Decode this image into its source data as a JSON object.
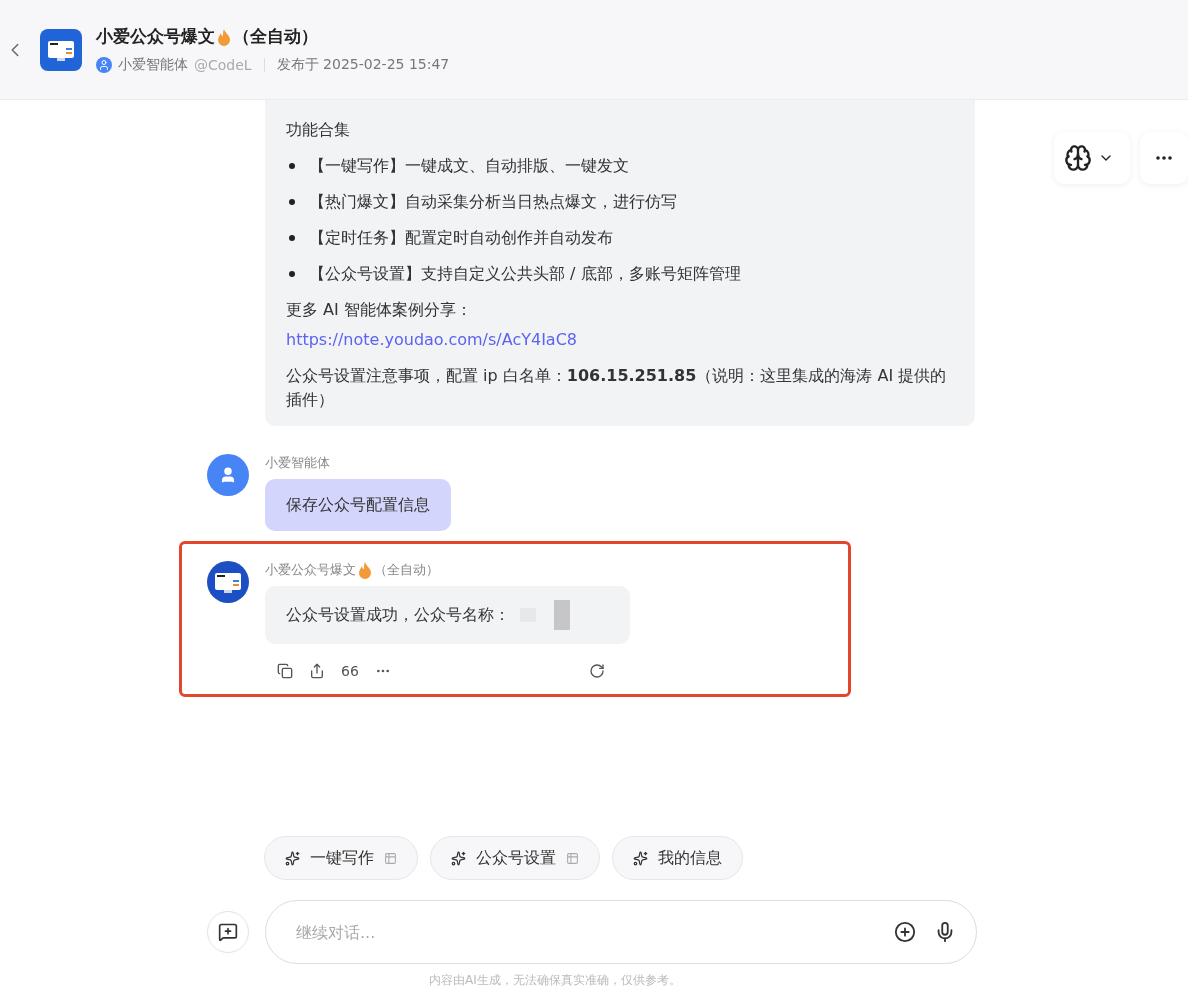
{
  "header": {
    "title": "小爱公众号爆文",
    "title_suffix": "（全自动）",
    "author": "小爱智能体",
    "handle": "@CodeL",
    "published": "发布于 2025-02-25 15:47"
  },
  "intro_message": {
    "heading": "功能合集",
    "features": [
      "【一键写作】一键成文、自动排版、一键发文",
      "【热门爆文】自动采集分析当日热点爆文，进行仿写",
      "【定时任务】配置定时自动创作并自动发布",
      "【公众号设置】支持自定义公共头部 / 底部，多账号矩阵管理"
    ],
    "more_label": "更多 AI 智能体案例分享：",
    "link": "https://note.youdao.com/s/AcY4IaC8",
    "note": "公众号设置注意事项，配置 ip 白名单：**106.15.251.85**（说明：这里集成的海涛 AI 提供的插件）"
  },
  "messages": [
    {
      "kind": "user",
      "sender": "小爱智能体",
      "text": "保存公众号配置信息",
      "highlighted": false
    },
    {
      "kind": "bot",
      "sender": "小爱公众号爆文",
      "sender_suffix": "（全自动）",
      "text": "公众号设置成功，公众号名称：",
      "redacted": true,
      "quote_count": "66",
      "highlighted": true
    }
  ],
  "suggestions": [
    {
      "label": "一键写作",
      "has_table": true
    },
    {
      "label": "公众号设置",
      "has_table": true
    },
    {
      "label": "我的信息",
      "has_table": false
    }
  ],
  "composer": {
    "placeholder": "继续对话..."
  },
  "disclaimer": "内容由AI生成，无法确保真实准确，仅供参考。"
}
